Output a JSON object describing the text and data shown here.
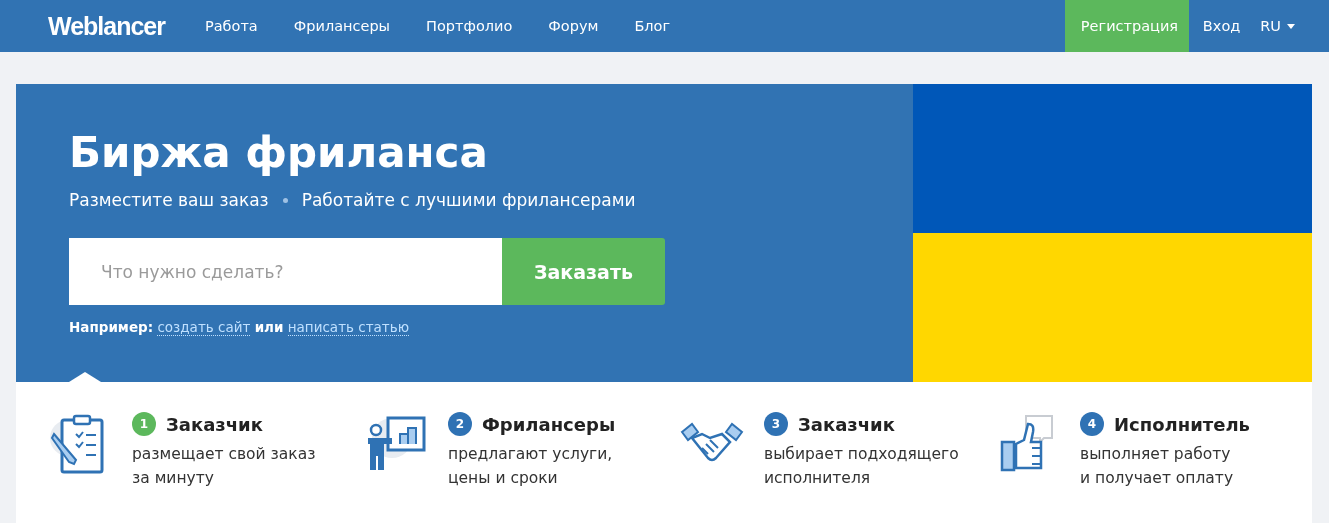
{
  "header": {
    "logo": "Weblancer",
    "nav": [
      "Работа",
      "Фрилансеры",
      "Портфолио",
      "Форум",
      "Блог"
    ],
    "register": "Регистрация",
    "login": "Вход",
    "language": "RU"
  },
  "hero": {
    "title": "Биржа фриланса",
    "subtitle": [
      "Разместите ваш заказ",
      "Работайте с лучшими фрилансерами"
    ],
    "search": {
      "placeholder": "Что нужно сделать?",
      "button": "Заказать"
    },
    "example": {
      "label": "Например:",
      "links": [
        "создать сайт",
        "написать статью"
      ],
      "joiner": "или"
    }
  },
  "steps": [
    {
      "number": "1",
      "color": "#5cb85c",
      "title": "Заказчик",
      "text": [
        "размещает свой заказ",
        "за минуту"
      ]
    },
    {
      "number": "2",
      "color": "#2f72b4",
      "title": "Фрилансеры",
      "text": [
        "предлагают услуги,",
        "цены и сроки"
      ]
    },
    {
      "number": "3",
      "color": "#2f72b4",
      "title": "Заказчик",
      "text": [
        "выбирает подходящего",
        "исполнителя"
      ]
    },
    {
      "number": "4",
      "color": "#2f72b4",
      "title": "Исполнитель",
      "text": [
        "выполняет работу",
        "и получает оплату"
      ]
    }
  ]
}
